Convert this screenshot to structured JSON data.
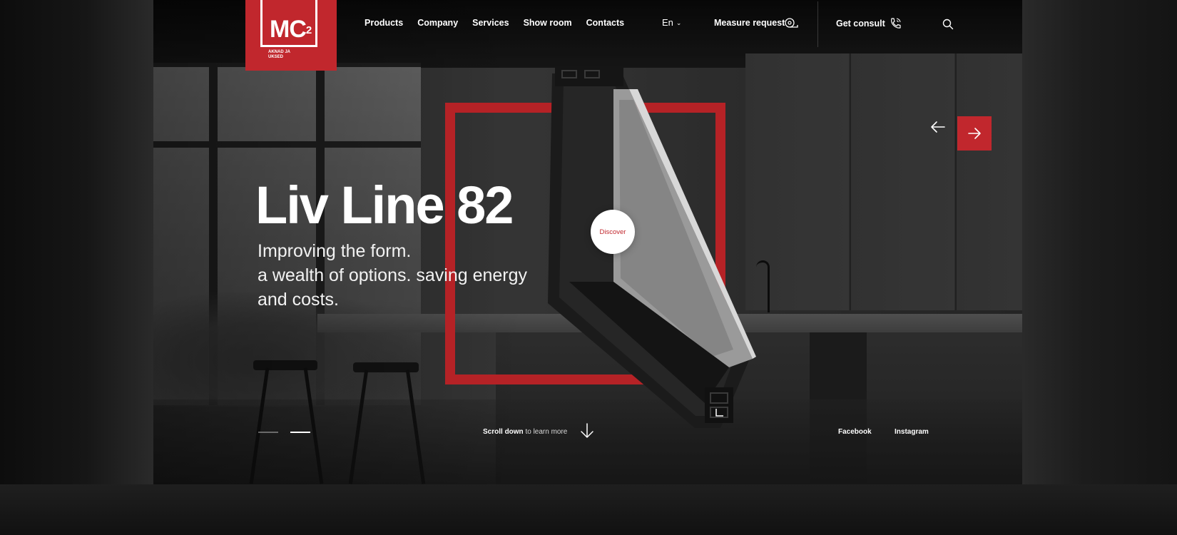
{
  "brand": {
    "logo_text": "MC",
    "logo_superscript": "2",
    "logo_subtitle_line1": "AKNAD JA",
    "logo_subtitle_line2": "UKSED",
    "accent_color": "#c1272d"
  },
  "nav": {
    "items": [
      {
        "label": "Products"
      },
      {
        "label": "Company"
      },
      {
        "label": "Services"
      },
      {
        "label": "Show room"
      },
      {
        "label": "Contacts"
      }
    ]
  },
  "header": {
    "language": "En",
    "language_icon": "chevron-down-icon",
    "measure_label": "Measure request",
    "measure_icon": "measure-tape-icon",
    "consult_label": "Get consult",
    "consult_icon": "phone-icon",
    "search_icon": "search-icon"
  },
  "hero": {
    "title": "Liv Line 82",
    "subtitle_line1": "Improving the form.",
    "subtitle_line2": "a wealth of options. saving energy",
    "subtitle_line3": "and costs.",
    "discover_label": "Discover"
  },
  "slider": {
    "prev_icon": "arrow-left-icon",
    "next_icon": "arrow-right-icon",
    "active_slide_index": 2,
    "total_slides": 2
  },
  "footer_bar": {
    "scroll_bold": "Scroll down",
    "scroll_light": "to learn more",
    "scroll_icon": "arrow-down-icon",
    "social": [
      {
        "label": "Facebook"
      },
      {
        "label": "Instagram"
      }
    ]
  }
}
